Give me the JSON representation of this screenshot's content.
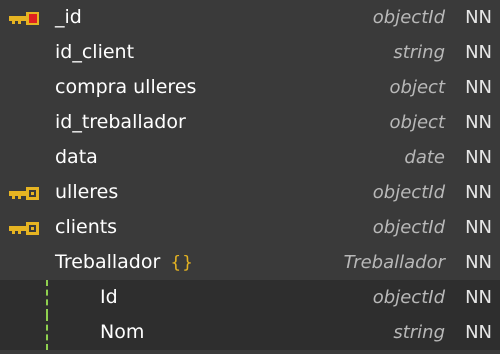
{
  "fields": [
    {
      "name": "_id",
      "type": "objectId",
      "null_flag": "NN",
      "key": "primary"
    },
    {
      "name": "id_client",
      "type": "string",
      "null_flag": "NN",
      "key": ""
    },
    {
      "name": "compra ulleres",
      "type": "object",
      "null_flag": "NN",
      "key": ""
    },
    {
      "name": "id_treballador",
      "type": "object",
      "null_flag": "NN",
      "key": ""
    },
    {
      "name": "data",
      "type": "date",
      "null_flag": "NN",
      "key": ""
    },
    {
      "name": "ulleres",
      "type": "objectId",
      "null_flag": "NN",
      "key": "foreign"
    },
    {
      "name": "clients",
      "type": "objectId",
      "null_flag": "NN",
      "key": "foreign"
    },
    {
      "name": "Treballador",
      "braces": "{}",
      "type": "Treballador",
      "null_flag": "NN",
      "key": ""
    },
    {
      "name": "Id",
      "type": "objectId",
      "null_flag": "NN",
      "key": "",
      "nested": true
    },
    {
      "name": "Nom",
      "type": "string",
      "null_flag": "NN",
      "key": "",
      "nested": true
    }
  ],
  "colors": {
    "background": "#3a3a3a",
    "nested_background": "#2e2e2e",
    "key_gold": "#e6b422",
    "key_red": "#e02020",
    "type_text": "#b8b8b8",
    "braces": "#e6b422",
    "tree_guide": "#8fd14f"
  },
  "icons": {
    "primary_key": "primary-key-icon",
    "foreign_key": "foreign-key-icon"
  }
}
